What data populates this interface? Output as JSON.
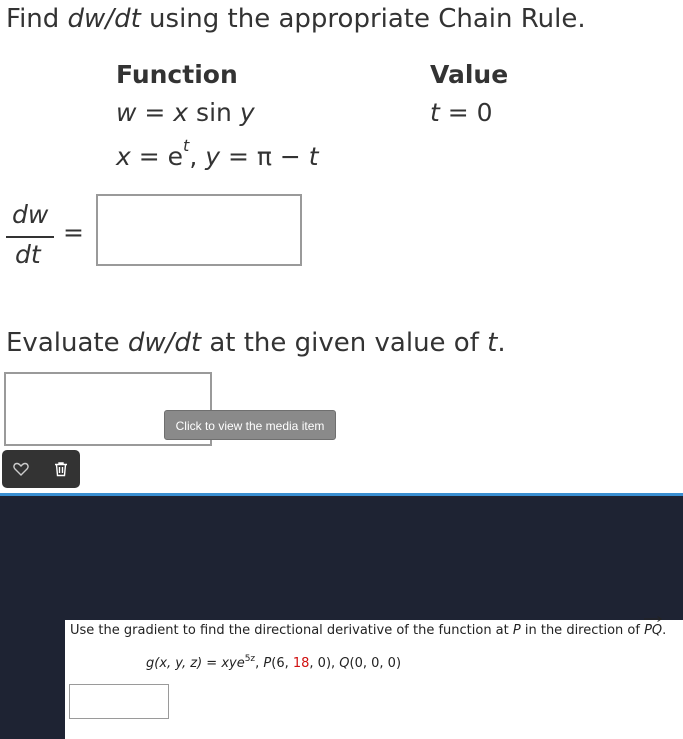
{
  "problem1": {
    "prompt_prefix": "Find",
    "prompt_var": "dw/dt",
    "prompt_suffix": "using the appropriate Chain Rule.",
    "header_function": "Function",
    "header_value": "Value",
    "eq_w_lhs": "w",
    "eq_w_mid": " = ",
    "eq_w_x": "x",
    "eq_w_sin": " sin ",
    "eq_w_y": "y",
    "eq_t_lhs": "t",
    "eq_t_rhs": " = 0",
    "eq_x_lhs": "x",
    "eq_x_mid": " = e",
    "eq_x_exp": "t",
    "eq_y_sep": ", ",
    "eq_y_lhs": "y",
    "eq_y_mid": " = π − ",
    "eq_y_t": "t",
    "frac_num": "dw",
    "frac_den": "dt",
    "equals": "=",
    "answer_value": "",
    "eval_prefix": "Evaluate",
    "eval_var": "dw/dt",
    "eval_mid": "at the given value of",
    "eval_t": "t",
    "eval_end": ".",
    "answer2_value": "",
    "media_button": "Click to view the media item"
  },
  "toolbar": {
    "heart_icon": "heart-icon",
    "trash_icon": "trash-icon"
  },
  "problem2": {
    "prompt_a": "Use the gradient to find the directional derivative of the function at ",
    "prompt_p": "P",
    "prompt_b": " in the direction of ",
    "prompt_pq": "PQ",
    "prompt_c": ".",
    "fn_g": "g",
    "fn_args": "(x, y, z)",
    "fn_eq": " = ",
    "fn_body": "xye",
    "fn_exp": "5z",
    "fn_sep": ",   ",
    "p_label": "P",
    "p_open": "(6, ",
    "p_red": "18",
    "p_close": ", 0), ",
    "q_label": "Q",
    "q_coords": "(0, 0, 0)",
    "answer_value": ""
  },
  "colors": {
    "text": "#333333",
    "dark_bg": "#1e2333",
    "accent_border": "#3a8fd2",
    "highlight": "#d01010",
    "button_bg": "#8a8a8a"
  }
}
